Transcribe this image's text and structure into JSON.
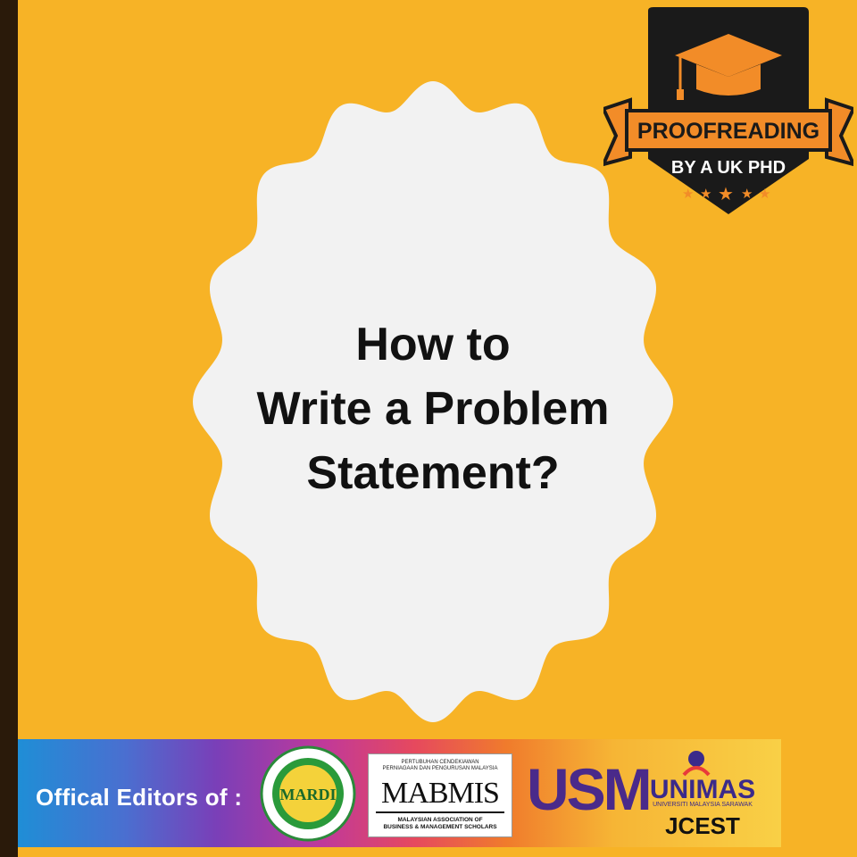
{
  "title": {
    "line1": "How to",
    "line2": "Write a Problem",
    "line3": "Statement?"
  },
  "badge": {
    "line1": "PROOFREADING",
    "line2": "BY A UK PHD",
    "icon": "graduation-cap-icon"
  },
  "banner": {
    "label": "Offical Editors of :",
    "logos": {
      "mardi": "MARDI",
      "mabmis_top1": "PERTUBUHAN CENDEKIAWAN",
      "mabmis_top2": "PERNIAGAAN DAN PENGURUSAN MALAYSIA",
      "mabmis": "MABMIS",
      "mabmis_bottom1": "MALAYSIAN ASSOCIATION OF",
      "mabmis_bottom2": "BUSINESS & MANAGEMENT SCHOLARS",
      "usm": "USM",
      "unimas": "UNIMAS",
      "unimas_sub": "UNIVERSITI MALAYSIA SARAWAK",
      "jcest": "JCEST"
    }
  },
  "colors": {
    "background": "#f7b326",
    "blob": "#f2f2f2",
    "badge_dark": "#1a1a1a",
    "badge_orange": "#f28c28"
  }
}
